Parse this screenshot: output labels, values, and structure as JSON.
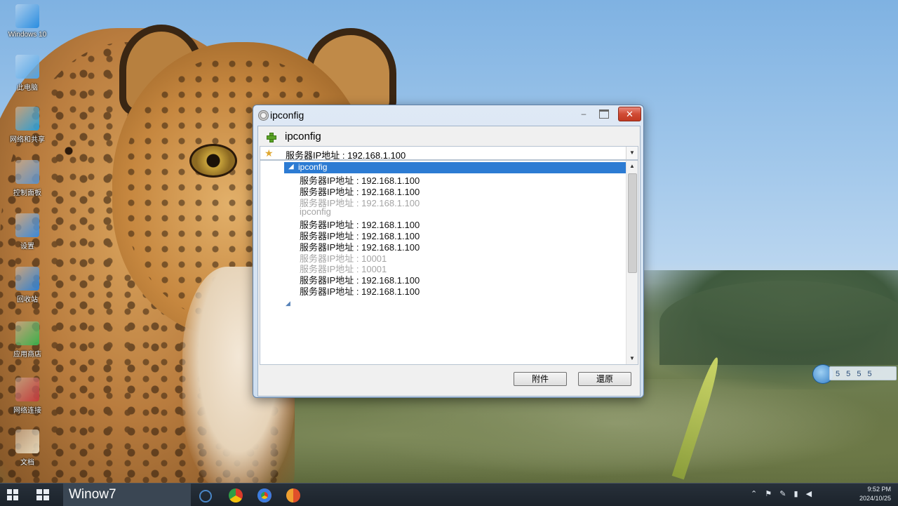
{
  "dialog": {
    "title": "ipconfig",
    "header_label": "ipconfig",
    "combo_value": "服务器IP地址 : 192.168.1.100",
    "selected_item": "ipconfig",
    "items": [
      {
        "text": "服务器IP地址 : 192.168.1.100",
        "faded": false
      },
      {
        "text": "服务器IP地址 : 192.168.1.100",
        "faded": false
      },
      {
        "text": "服务器IP地址 : 192.168.1.100",
        "faded": true
      },
      {
        "text": "ipconfig",
        "faded": true
      },
      {
        "text": "服务器IP地址 : 192.168.1.100",
        "faded": false
      },
      {
        "text": "服务器IP地址 : 192.168.1.100",
        "faded": false
      },
      {
        "text": "服务器IP地址 : 192.168.1.100",
        "faded": false
      },
      {
        "text": "服务器IP地址 : 10001",
        "faded": true
      },
      {
        "text": "服务器IP地址 : 10001",
        "faded": true
      },
      {
        "text": "服务器IP地址 : 192.168.1.100",
        "faded": false
      },
      {
        "text": "服务器IP地址 : 192.168.1.100",
        "faded": false
      }
    ],
    "ok_label": "附件",
    "cancel_label": "還原",
    "close_glyph": "✕",
    "minimize_glyph": "‒"
  },
  "desktop_icons": [
    {
      "label": "Windows 10",
      "color": "#2a8de0"
    },
    {
      "label": "此电脑",
      "color": "#4ea3e6"
    },
    {
      "label": "网络和共享",
      "color": "#2b9bd1"
    },
    {
      "label": "控制面板",
      "color": "#5e8fc2"
    },
    {
      "label": "设置",
      "color": "#3a88d8"
    },
    {
      "label": "回收站",
      "color": "#2f7fd0"
    },
    {
      "label": "应用商店",
      "color": "#3cae4a"
    },
    {
      "label": "网络连接",
      "color": "#c23a3a"
    },
    {
      "label": "文档",
      "color": "#e6d7b8"
    }
  ],
  "side_widget": {
    "text": "5 5 5 5"
  },
  "taskbar": {
    "title": "Winow7",
    "clock_time": "9:52 PM",
    "clock_date": "2024/10/25"
  }
}
